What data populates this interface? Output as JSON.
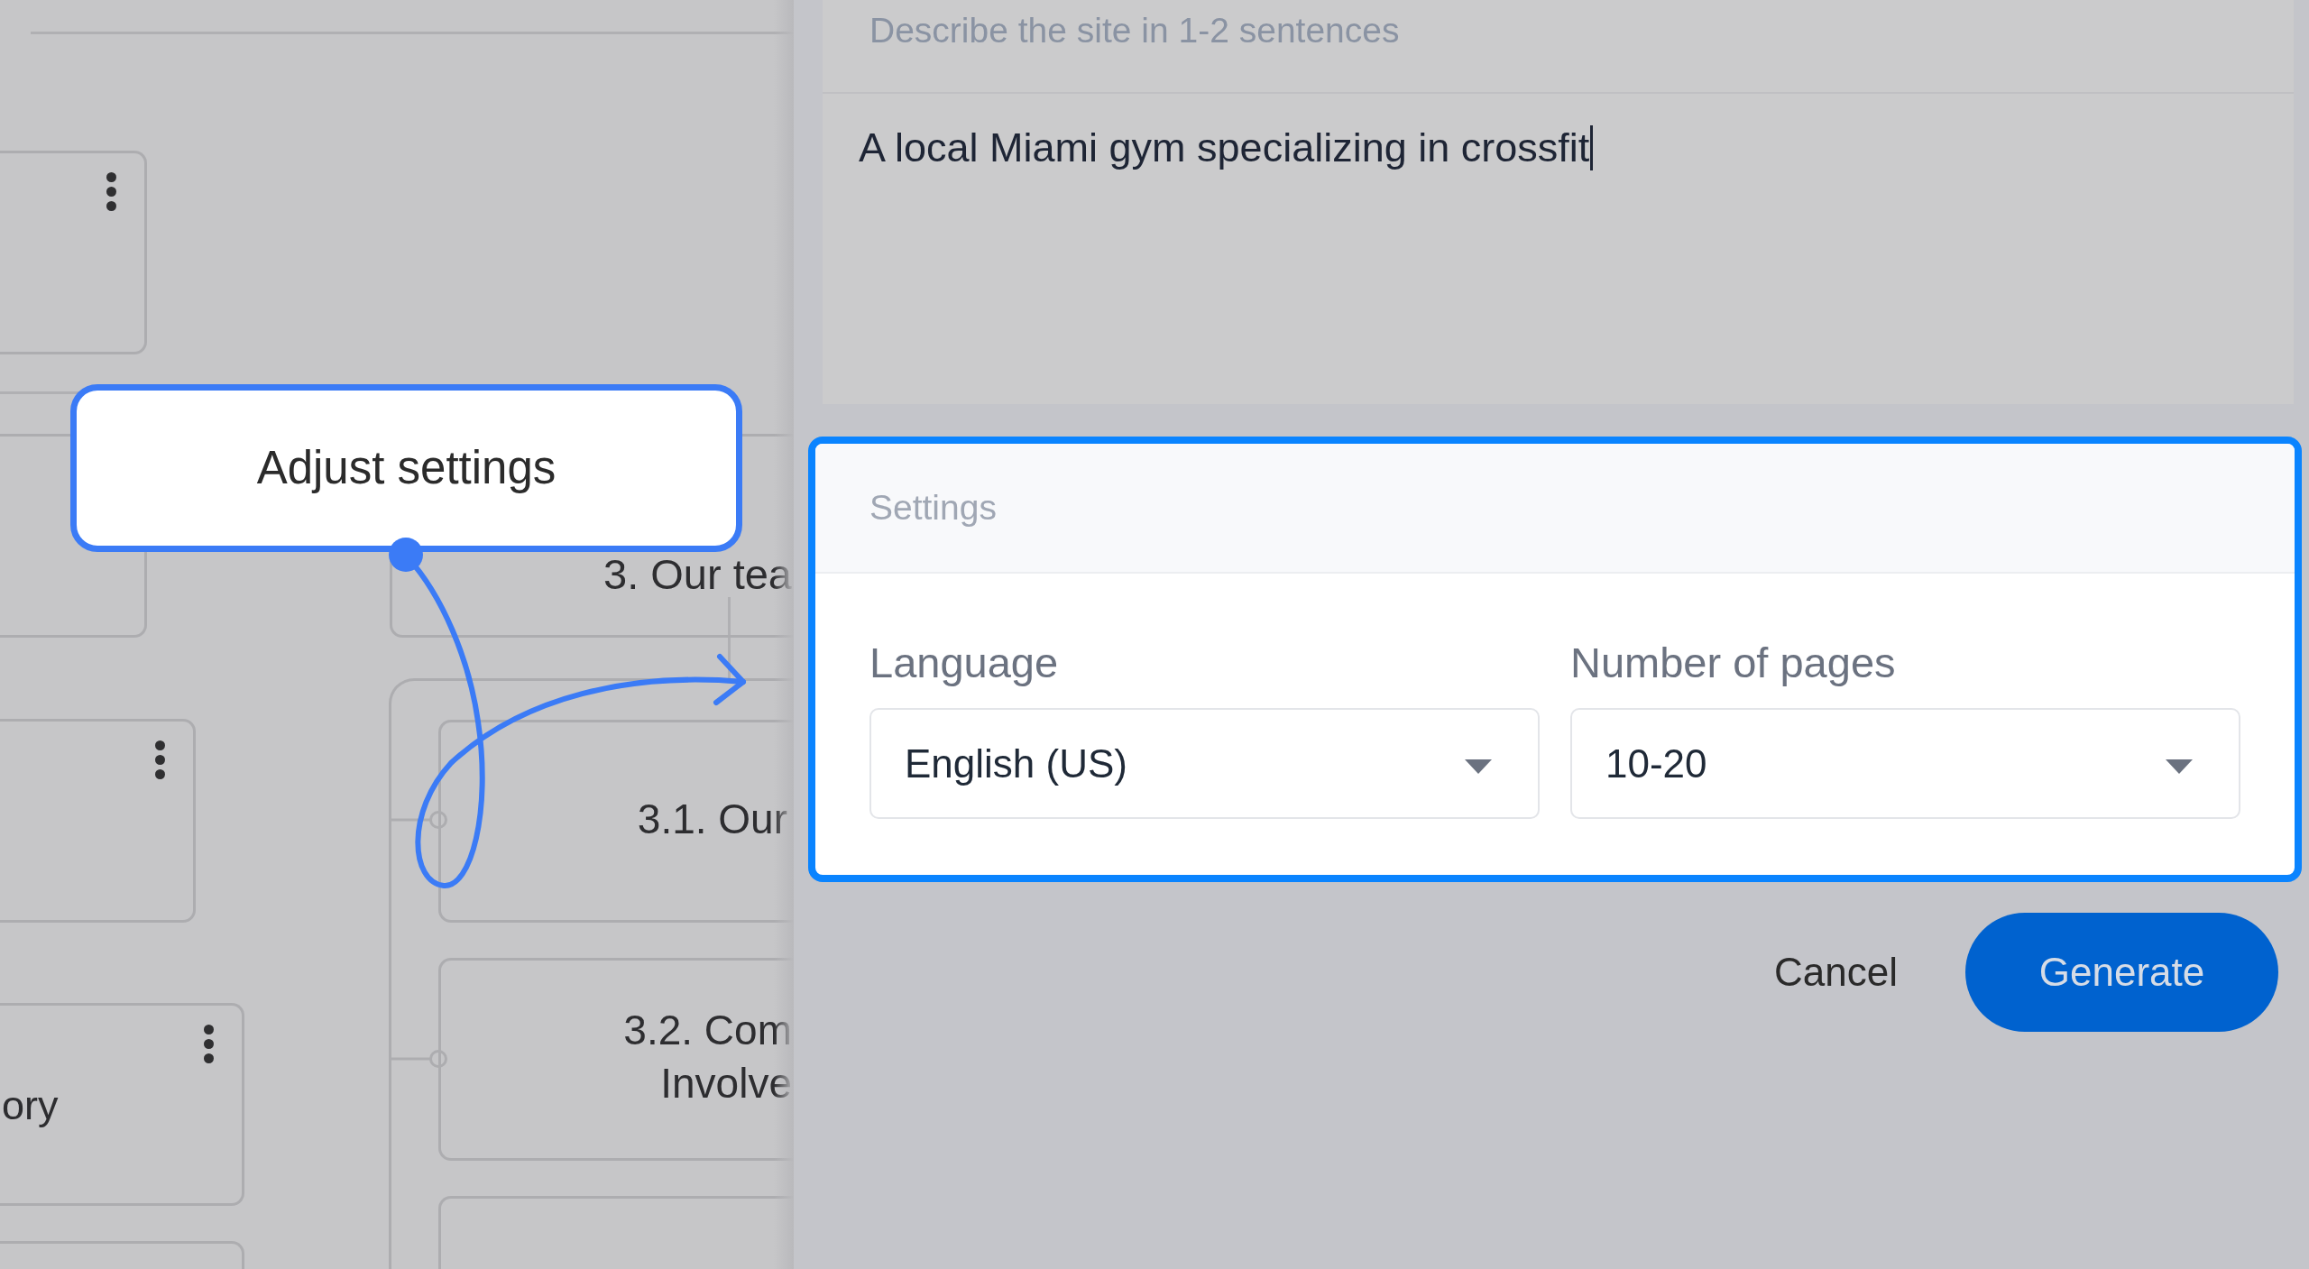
{
  "sitemap": {
    "cards": [
      {
        "menu": true
      },
      {
        "menu": true
      },
      {
        "title": "ory",
        "menu": true
      }
    ],
    "section": {
      "title": "3. Our tea",
      "children": [
        {
          "title": "3.1. Our"
        },
        {
          "title": "3.2. Com Involve"
        }
      ]
    }
  },
  "callout": {
    "text": "Adjust settings"
  },
  "description": {
    "label": "Describe the site in 1-2 sentences",
    "value": "A local Miami gym specializing in crossfit",
    "focused": true
  },
  "settings": {
    "title": "Settings",
    "highlighted": true,
    "fields": [
      {
        "label": "Language",
        "value": "English (US)"
      },
      {
        "label": "Number of pages",
        "value": "10-20"
      }
    ]
  },
  "actions": [
    {
      "label": "Cancel",
      "kind": "secondary"
    },
    {
      "label": "Generate",
      "kind": "primary"
    }
  ]
}
